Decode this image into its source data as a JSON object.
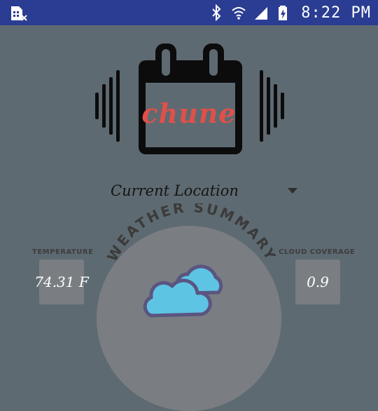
{
  "status_bar": {
    "time": "8:22 PM",
    "icons": [
      "sim-card-x-icon",
      "bluetooth-icon",
      "wifi-icon",
      "cell-signal-icon",
      "battery-charging-icon"
    ]
  },
  "app": {
    "logo_text": "chune",
    "location_selected": "Current Location"
  },
  "summary": {
    "title": "WEATHER SUMMARY",
    "temperature_label": "TEMPERATURE",
    "temperature_value": "74.31 F",
    "cloud_label": "CLOUD COVERAGE",
    "cloud_value": "0.9",
    "weather_icon": "cloud-icon"
  },
  "colors": {
    "status_bar": "#2a3d92",
    "background": "#5e6a71",
    "logo_accent": "#e0504a",
    "cloud_fill": "#5ec4e4",
    "cloud_outline": "#5a5580"
  }
}
